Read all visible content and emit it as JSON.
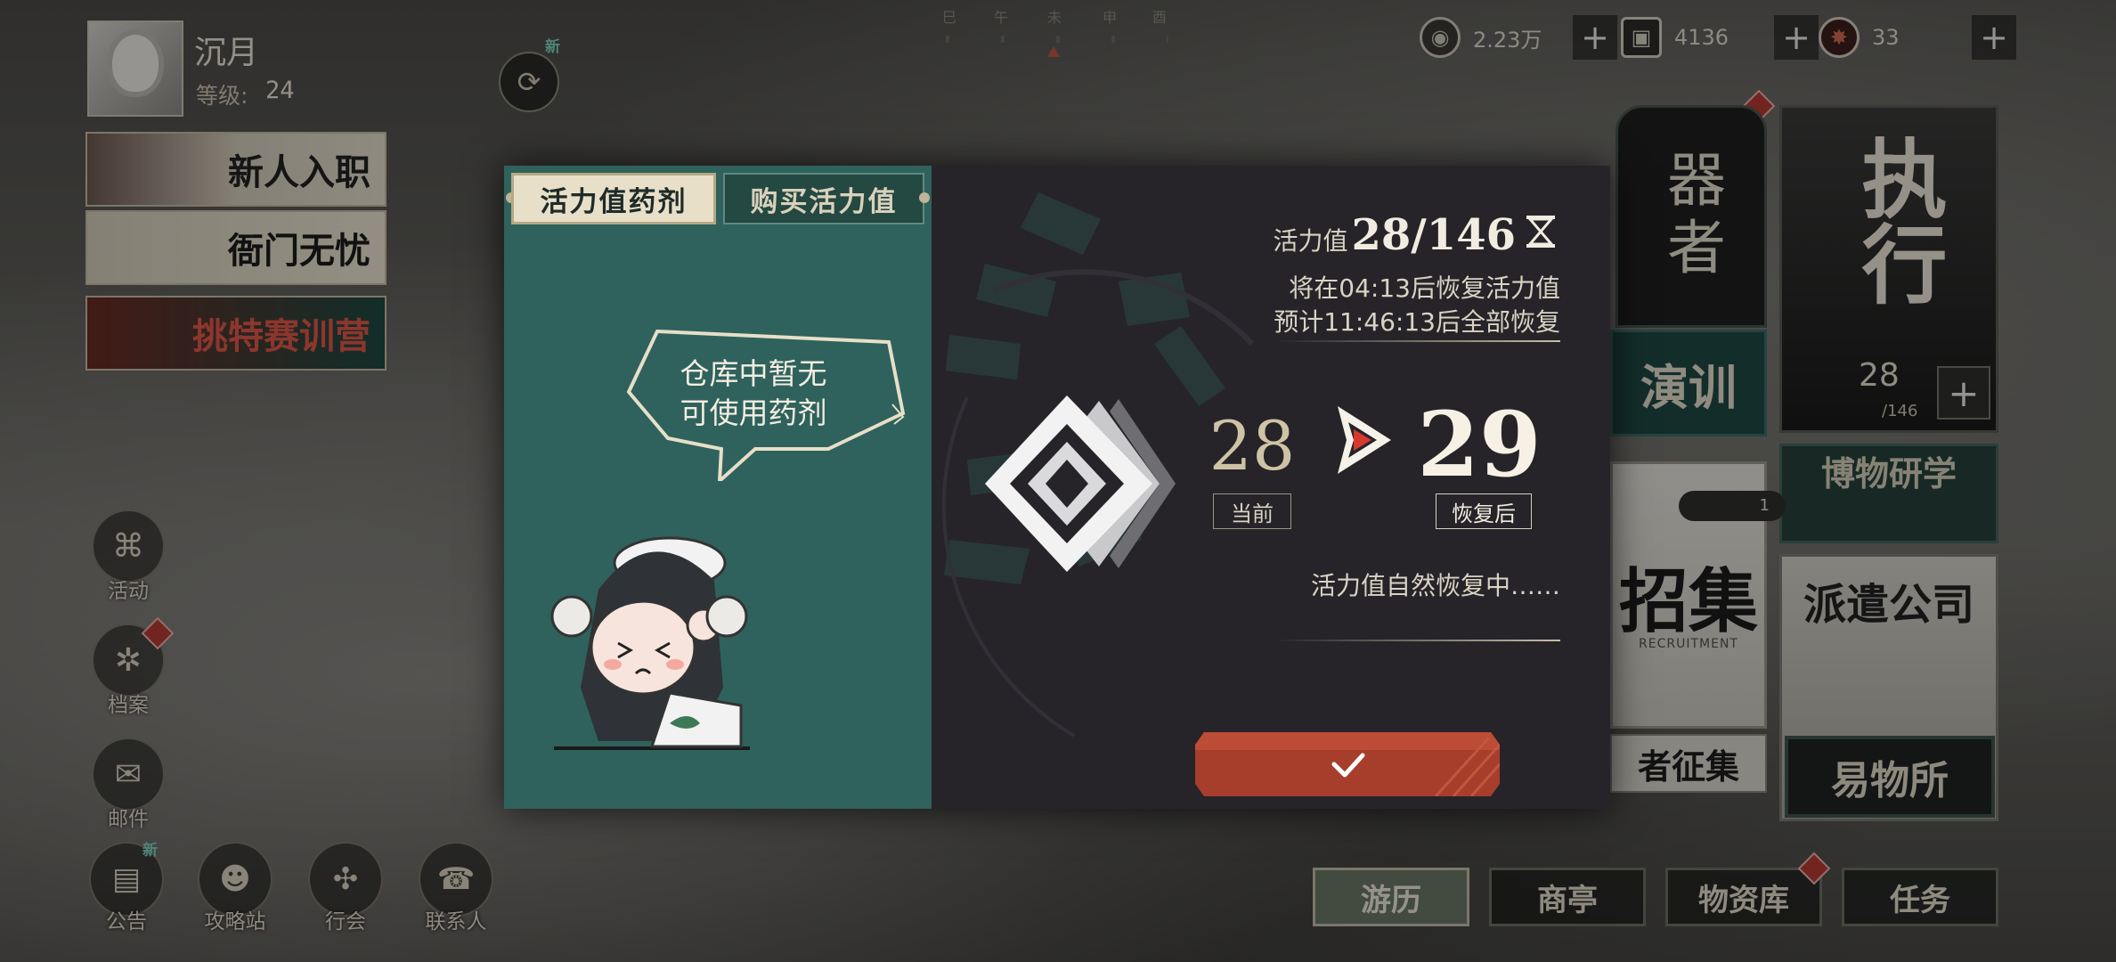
{
  "player": {
    "name": "沉月",
    "level_label": "等级:",
    "level": "24"
  },
  "time_labels": [
    "巳",
    "午",
    "未",
    "申",
    "酉"
  ],
  "resources": [
    {
      "icon": "coin-icon",
      "value": "2.23万"
    },
    {
      "icon": "ticket-icon",
      "value": "4136"
    },
    {
      "icon": "gem-icon",
      "value": "33"
    }
  ],
  "new_badge": "新",
  "banners": [
    "新人入职",
    "衙门无忧",
    "挑特赛训营"
  ],
  "side_menu": [
    "活动",
    "档案",
    "邮件"
  ],
  "bottom_menu": [
    "公告",
    "攻略站",
    "行会",
    "联系人"
  ],
  "right_panels": {
    "qizhe": "器者",
    "zhixing": "执行",
    "zhixing_value": "28",
    "zhixing_max": "/146",
    "yanxun": "演训",
    "bowu": "博物研学",
    "zhaoji": "招集",
    "zhaoji_sub": "RECRUITMENT",
    "zhaoji_count": "1",
    "zhengji": "者征集",
    "paiqian": "派遣公司",
    "yiwu": "易物所"
  },
  "bottom_nav": [
    "游历",
    "商亭",
    "物资库",
    "任务"
  ],
  "modal": {
    "tabs": [
      "活力值药剂",
      "购买活力值"
    ],
    "empty_text_1": "仓库中暂无",
    "empty_text_2": "可使用药剂",
    "stamina_key": "活力值",
    "stamina_value": "28/146",
    "recover_next": "将在04:13后恢复活力值",
    "recover_full": "预计11:46:13后全部恢复",
    "current_value": "28",
    "current_label": "当前",
    "after_value": "29",
    "after_label": "恢复后",
    "status": "活力值自然恢复中……"
  },
  "colors": {
    "modal_left": "#2f625c",
    "modal_right": "#262429",
    "confirm": "#b0432e",
    "accent_red": "#d43a30"
  }
}
